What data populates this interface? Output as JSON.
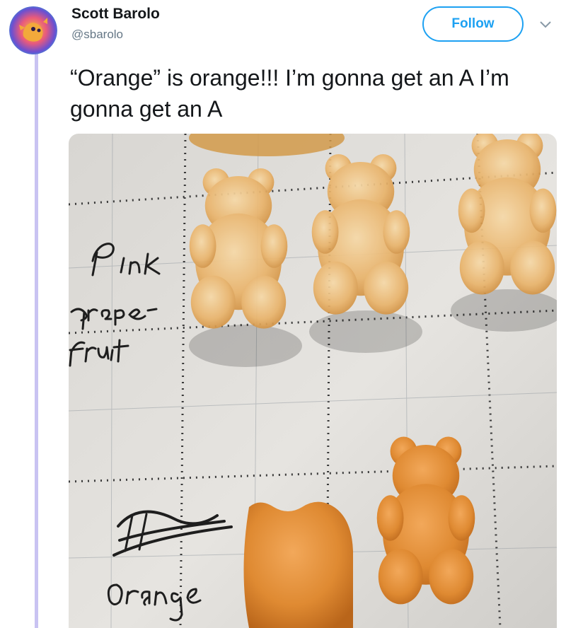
{
  "tweet": {
    "author_name": "Scott Barolo",
    "author_handle": "@sbarolo",
    "follow_label": "Follow",
    "text": "“Orange” is orange!!! I’m gonna get an A I’m gonna get an A"
  },
  "photo": {
    "handwritten_labels": [
      "Pink",
      "grape-fruit",
      "Orange",
      "Orange"
    ]
  },
  "colors": {
    "brand_blue": "#1da1f2",
    "thread_line": "#c9c3f2",
    "handle_gray": "#657786"
  },
  "icons": [
    "avatar-creature",
    "chevron-down-icon"
  ]
}
